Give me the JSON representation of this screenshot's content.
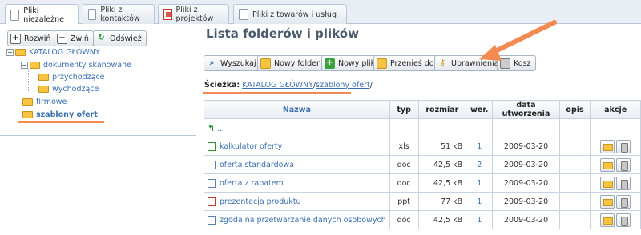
{
  "tabs": [
    {
      "label": "Pliki niezależne",
      "active": true
    },
    {
      "label": "Pliki z kontaktów"
    },
    {
      "label": "Pliki z projektów"
    },
    {
      "label": "Pliki z towarów i usług"
    }
  ],
  "left_toolbar": {
    "expand": "Rozwiń",
    "collapse": "Zwiń",
    "refresh": "Odśwież"
  },
  "tree": {
    "root": "KATALOG GŁÓWNY",
    "scanned": "dokumenty skanowane",
    "incoming": "przychodzące",
    "outgoing": "wychodzące",
    "company": "firmowe",
    "templates": "szablony ofert"
  },
  "main": {
    "title": "Lista folderów i plików",
    "toolbar": {
      "search": "Wyszukaj",
      "new_folder": "Nowy folder",
      "new_file": "Nowy plik",
      "move": "Przenieś do",
      "permissions": "Uprawnienia",
      "trash": "Kosz"
    },
    "path": {
      "label": "Ścieżka:",
      "root": "KATALOG GŁÓWNY",
      "sep": "/",
      "current": "szablony ofert",
      "trail": "/"
    },
    "columns": {
      "name": "Nazwa",
      "type": "typ",
      "size": "rozmiar",
      "ver": "wer.",
      "created": "data utworzenia",
      "desc": "opis",
      "actions": "akcje"
    },
    "up_label": "..",
    "files": [
      {
        "name": "kalkulator oferty",
        "type": "xls",
        "size": "51 kB",
        "ver": "1",
        "created": "2009-03-20",
        "desc": ""
      },
      {
        "name": "oferta standardowa",
        "type": "doc",
        "size": "42,5 kB",
        "ver": "2",
        "created": "2009-03-20",
        "desc": ""
      },
      {
        "name": "oferta z rabatem",
        "type": "doc",
        "size": "42,5 kB",
        "ver": "1",
        "created": "2009-03-20",
        "desc": ""
      },
      {
        "name": "prezentacja produktu",
        "type": "ppt",
        "size": "77 kB",
        "ver": "1",
        "created": "2009-03-20",
        "desc": ""
      },
      {
        "name": "zgoda na przetwarzanie danych osobowych",
        "type": "doc",
        "size": "42,5 kB",
        "ver": "1",
        "created": "2009-03-20",
        "desc": ""
      }
    ]
  },
  "colors": {
    "accent": "#3a6fb0",
    "highlight": "#f28a52",
    "folder": "#f5c542"
  }
}
